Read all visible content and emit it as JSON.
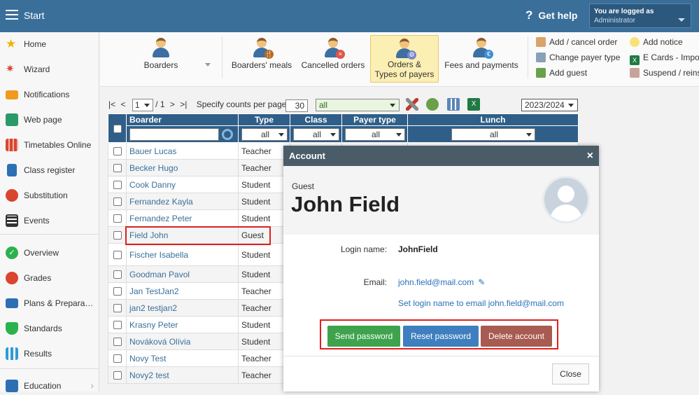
{
  "topbar": {
    "start_label": "Start",
    "help_label": "Get help",
    "logged_in_label": "You are logged as",
    "logged_in_user": "Administrator"
  },
  "sidebar": {
    "items": [
      {
        "label": "Home",
        "icon": "star-icon",
        "color": "#f0b400"
      },
      {
        "label": "Wizard",
        "icon": "magic-wand-icon",
        "color": "#d9452f"
      },
      {
        "label": "Notifications",
        "icon": "envelope-icon",
        "color": "#f09a1a"
      },
      {
        "label": "Web page",
        "icon": "house-icon",
        "color": "#2a9a6a"
      },
      {
        "label": "Timetables Online",
        "icon": "timetable-icon",
        "color": "#d9452f"
      },
      {
        "label": "Class register",
        "icon": "book-icon",
        "color": "#2d6fb3"
      },
      {
        "label": "Substitution",
        "icon": "person-swap-icon",
        "color": "#d9452f"
      },
      {
        "label": "Events",
        "icon": "calendar-icon",
        "color": "#333333"
      },
      {
        "label": "Overview",
        "icon": "checkmark-icon",
        "color": "#2bb24c"
      },
      {
        "label": "Grades",
        "icon": "target-icon",
        "color": "#d9452f"
      },
      {
        "label": "Plans & Preparations",
        "icon": "briefcase-icon",
        "color": "#2d6fb3"
      },
      {
        "label": "Standards",
        "icon": "shield-icon",
        "color": "#2bb24c"
      },
      {
        "label": "Results",
        "icon": "bar-chart-icon",
        "color": "#2d9bd6"
      },
      {
        "label": "Education",
        "icon": "graduation-icon",
        "color": "#2d6fb3"
      }
    ]
  },
  "toolbar": {
    "boarders": "Boarders",
    "boarders_meals": "Boarders' meals",
    "cancelled_orders": "Cancelled orders",
    "orders_line1": "Orders &",
    "orders_line2": "Types of payers",
    "fees": "Fees and payments",
    "add_cancel_order": "Add / cancel order",
    "change_payer_type": "Change payer type",
    "add_guest": "Add guest",
    "add_notice": "Add notice",
    "ecards": "E Cards - Impo",
    "suspend": "Suspend / reins"
  },
  "pager": {
    "first": "|<",
    "prev": "<",
    "page": "1",
    "of": "/ 1",
    "next": ">",
    "last": ">|",
    "per_page_label": "Specify counts per page:",
    "per_page_value": "30",
    "filter_value": "all",
    "year": "2023/2024"
  },
  "table": {
    "headers": {
      "boarder": "Boarder",
      "type": "Type",
      "class": "Class",
      "payer": "Payer type",
      "lunch": "Lunch"
    },
    "filters": {
      "type": "all",
      "class": "all",
      "payer": "all",
      "lunch": "all"
    },
    "rows": [
      {
        "name": "Bauer Lucas",
        "type": "Teacher"
      },
      {
        "name": "Becker Hugo",
        "type": "Teacher"
      },
      {
        "name": "Cook Danny",
        "type": "Student"
      },
      {
        "name": "Fernandez Kayla",
        "type": "Student"
      },
      {
        "name": "Fernandez Peter",
        "type": "Student"
      },
      {
        "name": "Field John",
        "type": "Guest"
      },
      {
        "name": "Fischer Isabella",
        "type": "Student"
      },
      {
        "name": "Goodman Pavol",
        "type": "Student"
      },
      {
        "name": "Jan TestJan2",
        "type": "Teacher"
      },
      {
        "name": "jan2 testjan2",
        "type": "Teacher"
      },
      {
        "name": "Krasny Peter",
        "type": "Student"
      },
      {
        "name": "Nováková Olívia",
        "type": "Student"
      },
      {
        "name": "Novy Test",
        "type": "Teacher"
      },
      {
        "name": "Novy2 test",
        "type": "Teacher"
      }
    ]
  },
  "modal": {
    "title": "Account",
    "close_icon": "×",
    "role": "Guest",
    "name": "John Field",
    "login_label": "Login name:",
    "login_value": "JohnField",
    "email_label": "Email:",
    "email_value": "john.field@mail.com",
    "set_login_link": "Set login name to email john.field@mail.com",
    "send_password": "Send password",
    "reset_password": "Reset password",
    "delete_account": "Delete account",
    "close_button": "Close"
  },
  "colors": {
    "topbar": "#3a6f9a",
    "send": "#3fa34d",
    "reset": "#3f7fbf",
    "delete": "#a85b50",
    "highlight": "#e02020"
  }
}
